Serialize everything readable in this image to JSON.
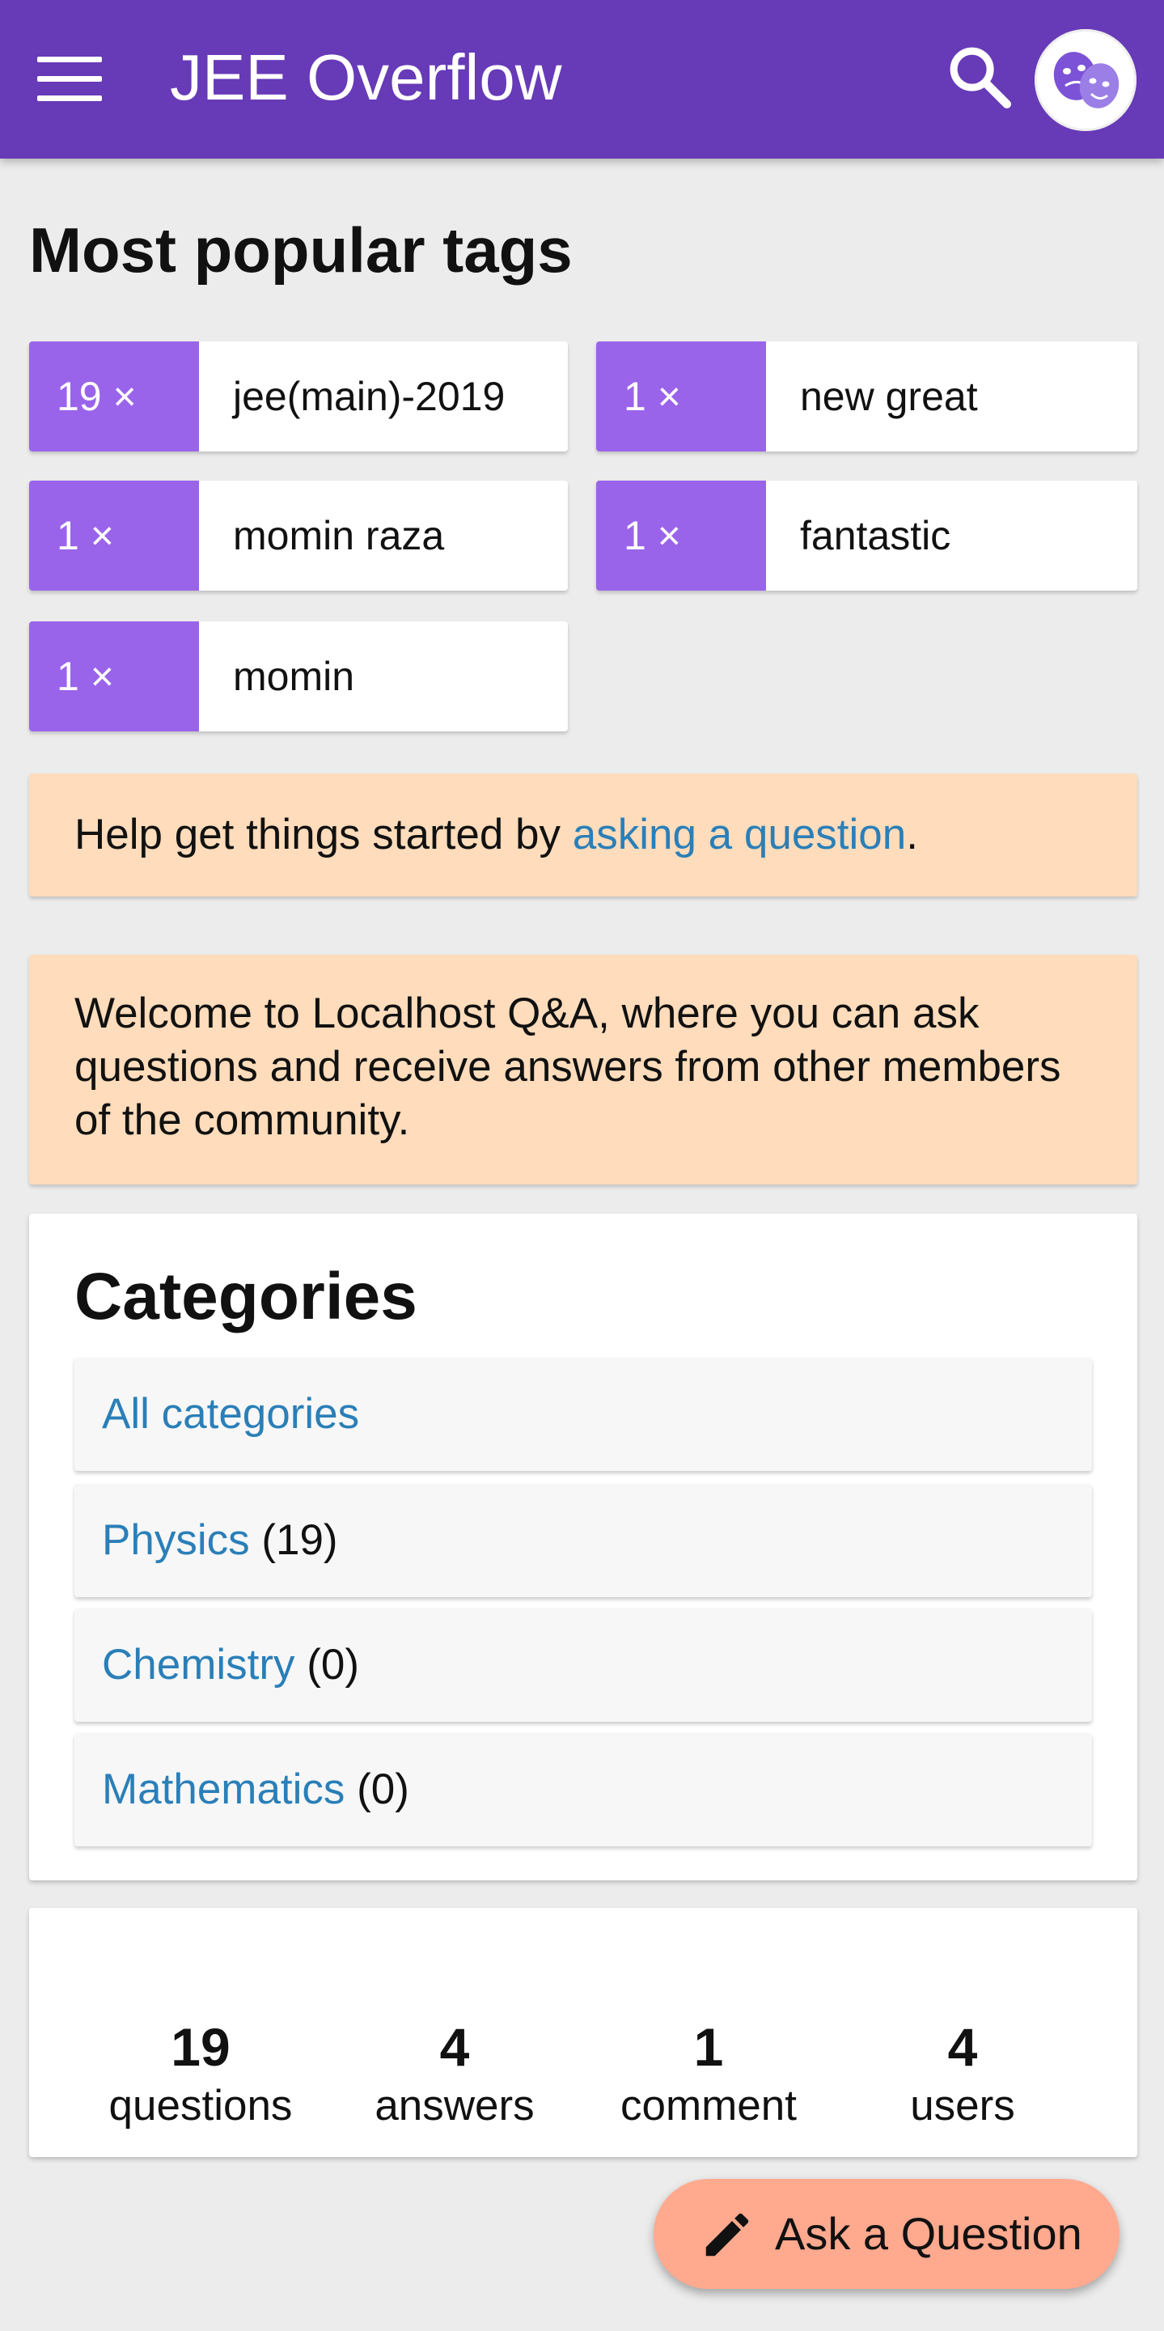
{
  "header": {
    "title": "JEE Overflow",
    "menu_icon": "hamburger-icon",
    "search_icon": "search-icon",
    "avatar_icon": "theater-masks-icon",
    "bg_color": "#673ab7"
  },
  "tags_section": {
    "title": "Most popular tags",
    "tags": [
      {
        "count": "19 ×",
        "name": "jee(main)-2019"
      },
      {
        "count": "1 ×",
        "name": "new great"
      },
      {
        "count": "1 ×",
        "name": "momin raza"
      },
      {
        "count": "1 ×",
        "name": "fantastic"
      },
      {
        "count": "1 ×",
        "name": "momin"
      }
    ],
    "count_color": "#9a64ea"
  },
  "notice_ask": {
    "prefix": "Help get things started by ",
    "link": "asking a question",
    "suffix": "."
  },
  "notice_welcome": {
    "text": "Welcome to Localhost Q&A, where you can ask questions and receive answers from other members of the community."
  },
  "categories": {
    "title": "Categories",
    "items": [
      {
        "label": "All categories",
        "count": ""
      },
      {
        "label": "Physics",
        "count": " (19)"
      },
      {
        "label": "Chemistry",
        "count": " (0)"
      },
      {
        "label": "Mathematics",
        "count": " (0)"
      }
    ]
  },
  "stats": [
    {
      "value": "19",
      "label": "questions"
    },
    {
      "value": "4",
      "label": "answers"
    },
    {
      "value": "1",
      "label": "comment"
    },
    {
      "value": "4",
      "label": "users"
    }
  ],
  "fab": {
    "label": "Ask a Question",
    "icon": "pencil-icon",
    "color": "#ffa98e"
  }
}
